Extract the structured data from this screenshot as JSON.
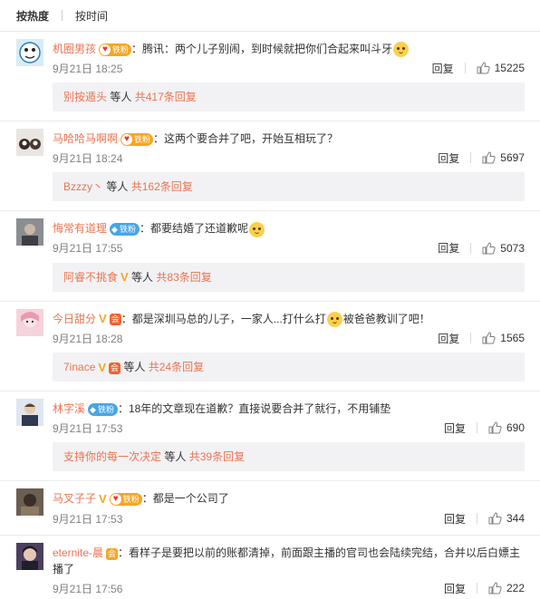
{
  "sort": {
    "hot": "按热度",
    "time": "按时间"
  },
  "labels": {
    "reply": "回复",
    "etc": "等人",
    "fan_badge": "铁粉"
  },
  "colors": {
    "link": "#eb7350",
    "subbox": "#f2f2f5",
    "fan_badge": "#f6a623",
    "tie_badge": "#48a5e6"
  },
  "comments": [
    {
      "user": "机圈男孩",
      "text_before": "：腾讯：两个儿子别闹，到时候就把你们合起来叫斗牙",
      "text_after": "",
      "emoji": "cute-emoji",
      "time": "9月21日 18:25",
      "likes": "15225",
      "sub_user": "别按遁头",
      "sub_count": "共417条回复"
    },
    {
      "user": "马哈哈马啊啊",
      "text_before": "：这两个要合并了吧，开始互相玩了？",
      "text_after": "",
      "time": "9月21日 18:24",
      "likes": "5697",
      "sub_user": "Bzzzy丶",
      "sub_count": "共162条回复"
    },
    {
      "user": "悔常有道理",
      "text_before": "：都要结婚了还道歉呢",
      "text_after": "",
      "emoji": "cute-emoji",
      "time": "9月21日 17:55",
      "likes": "5073",
      "sub_user": "阿睿不挑食",
      "sub_count": "共83条回复"
    },
    {
      "user": "今日甜分",
      "text_before": "：都是深圳马总的儿子，一家人...打什么打",
      "text_after": "被爸爸教训了吧！",
      "emoji": "cute-emoji",
      "time": "9月21日 18:28",
      "likes": "1565",
      "sub_user": "7inace",
      "sub_count": "共24条回复"
    },
    {
      "user": "林字溪",
      "text_before": "：18年的文章现在道歉？直接说要合并了就行，不用铺垫",
      "text_after": "",
      "time": "9月21日 17:53",
      "likes": "690",
      "sub_user": "支持你的每一次决定",
      "sub_count": "共39条回复"
    },
    {
      "user": "马叉子子",
      "text_before": "：都是一个公司了",
      "text_after": "",
      "time": "9月21日 17:53",
      "likes": "344"
    },
    {
      "user": "eternite-晨",
      "text_before": "：看样子是要把以前的账都清掉，前面跟主播的官司也会陆续完结，合并以后白嫖主播了",
      "text_after": "",
      "time": "9月21日 17:56",
      "likes": "222"
    }
  ]
}
